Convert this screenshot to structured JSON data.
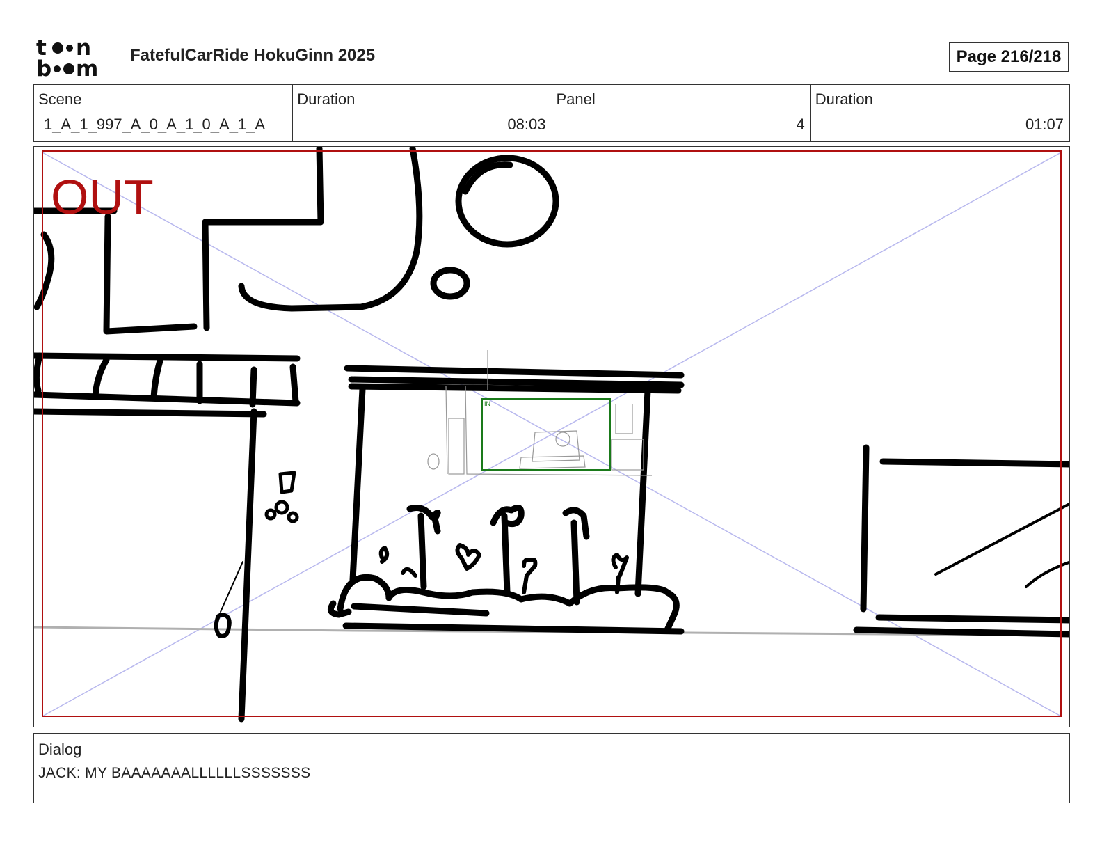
{
  "header": {
    "logo_name": "toon boom",
    "document_title": "FatefulCarRide HokuGinn 2025",
    "page_label": "Page 216/218"
  },
  "info": {
    "scene_label": "Scene",
    "scene_value": "1_A_1_997_A_0_A_1_0_A_1_A",
    "scene_duration_label": "Duration",
    "scene_duration_value": "08:03",
    "panel_label": "Panel",
    "panel_value": "4",
    "panel_duration_label": "Duration",
    "panel_duration_value": "01:07"
  },
  "panel": {
    "out_marker": "OUT",
    "in_marker": "IN",
    "colors": {
      "out_frame": "#b01010",
      "in_frame": "#1a7a1a",
      "guide_lines": "#b8b8ee",
      "ink": "#000000"
    }
  },
  "dialog": {
    "label": "Dialog",
    "text": "JACK: MY BAAAAAAALLLLLLSSSSSSS"
  }
}
